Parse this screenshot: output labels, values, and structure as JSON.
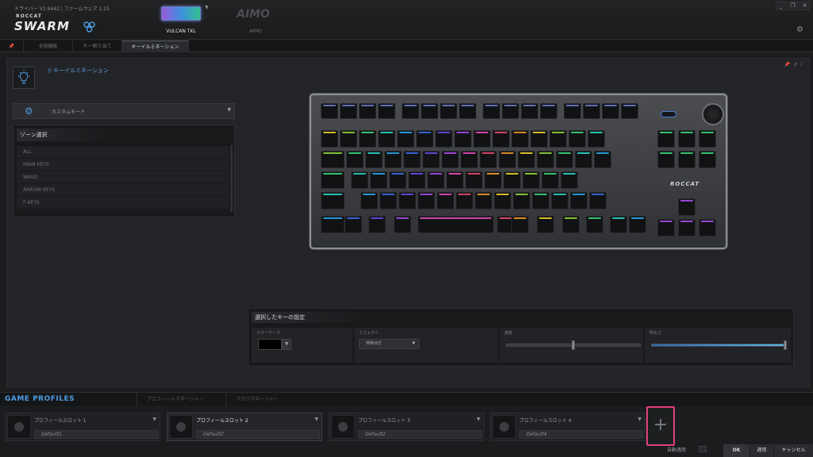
{
  "header": {
    "version": "ドライバー V1.9442 | ファームウェア 1.15",
    "logo_sub": "ROCCAT",
    "logo": "SWARM",
    "devices": [
      {
        "name": "VULCAN TKL",
        "active": true
      },
      {
        "name": "AIMO",
        "label": "AIMO",
        "active": false
      }
    ],
    "window_buttons": [
      "_",
      "❐",
      "✕"
    ],
    "settings_icon": "gear-icon"
  },
  "tabs": [
    {
      "label": "",
      "icon": "pin-icon"
    },
    {
      "label": "全般機能"
    },
    {
      "label": "キー割り当て"
    },
    {
      "label": "キーイルミネーション",
      "active": true
    }
  ],
  "section": {
    "title": "// キーイルミネーション",
    "icon": "lightbulb-icon",
    "mode_label": "カスタムモード"
  },
  "zones": {
    "title": "ゾーン選択",
    "items": [
      "ALL",
      "MAIN KEYS",
      "WASD",
      "ARROW KEYS",
      "F-KEYS"
    ]
  },
  "keyboard": {
    "brand": "ROCCAT"
  },
  "selected_key": {
    "title": "選択したキーの設定",
    "color_label": "カラーテーマ",
    "effect_label": "エフェクト",
    "effect_value": "常時点灯",
    "speed_label": "速度",
    "brightness_label": "明るさ",
    "speed_value": 0.5,
    "brightness_value": 1.0
  },
  "game_profiles": {
    "title": "GAME PROFILES",
    "tabs": [
      "プロフィールマネージャー",
      "マクロマネージャー"
    ],
    "slots": [
      {
        "name": "プロフィールスロット 1",
        "value": "Default1",
        "active": false
      },
      {
        "name": "プロフィールスロット 2",
        "value": "Default2",
        "active": true
      },
      {
        "name": "プロフィールスロット 3",
        "value": "Default2",
        "active": false
      },
      {
        "name": "プロフィールスロット 4",
        "value": "Default4",
        "active": false
      }
    ],
    "add_label": "+"
  },
  "footer": {
    "auto_apply": "自動適用",
    "ok": "OK",
    "apply": "適用",
    "cancel": "キャンセル"
  },
  "colors": {
    "accent": "#4d9de3",
    "highlight": "#e0407f"
  }
}
